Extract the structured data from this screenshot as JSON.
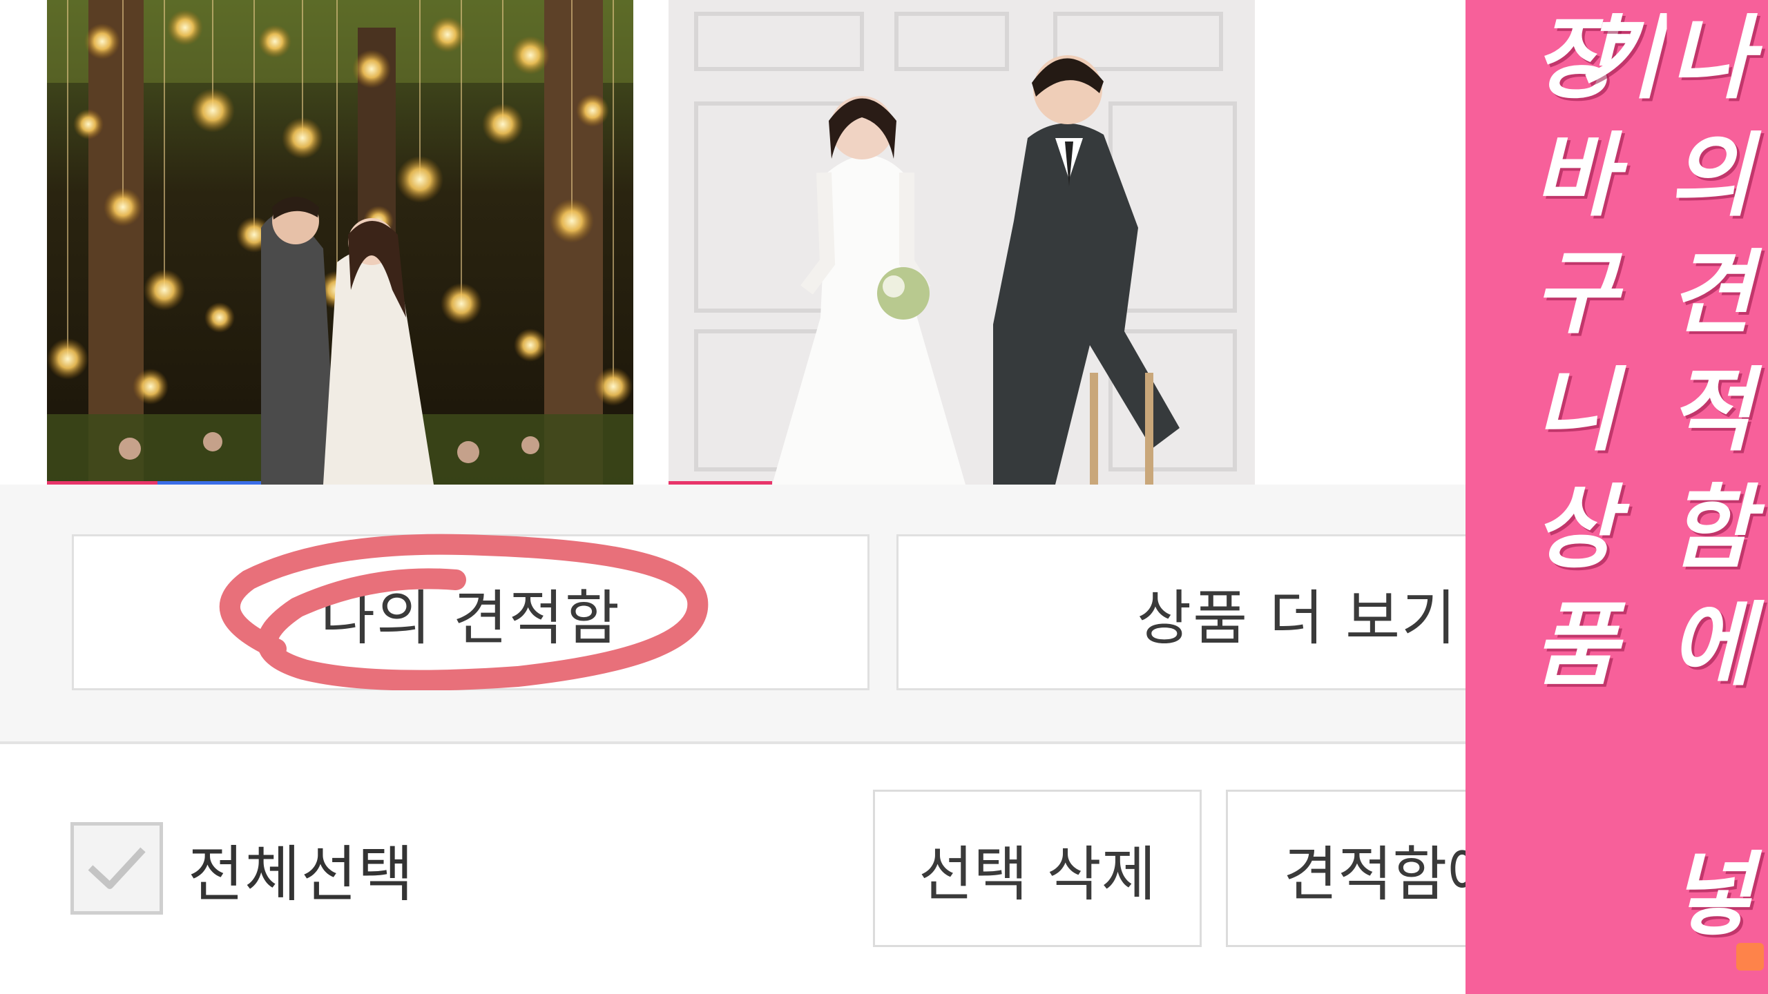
{
  "products": [
    {
      "name": "forest-lights-wedding-photo"
    },
    {
      "name": "studio-white-wedding-photo"
    }
  ],
  "band": {
    "my_quote_label": "나의 견적함",
    "more_products_label": "상품 더 보기"
  },
  "toolbar": {
    "select_all_label": "전체선택",
    "select_all_checked": true,
    "delete_label": "선택 삭제",
    "add_quote_label": "견적함에 넣기"
  },
  "caption": {
    "left_text": "장바구니상품",
    "right_text": "나의견적함에 넣기",
    "panel_color": "#f7609a",
    "circle_color": "#e8707a"
  }
}
